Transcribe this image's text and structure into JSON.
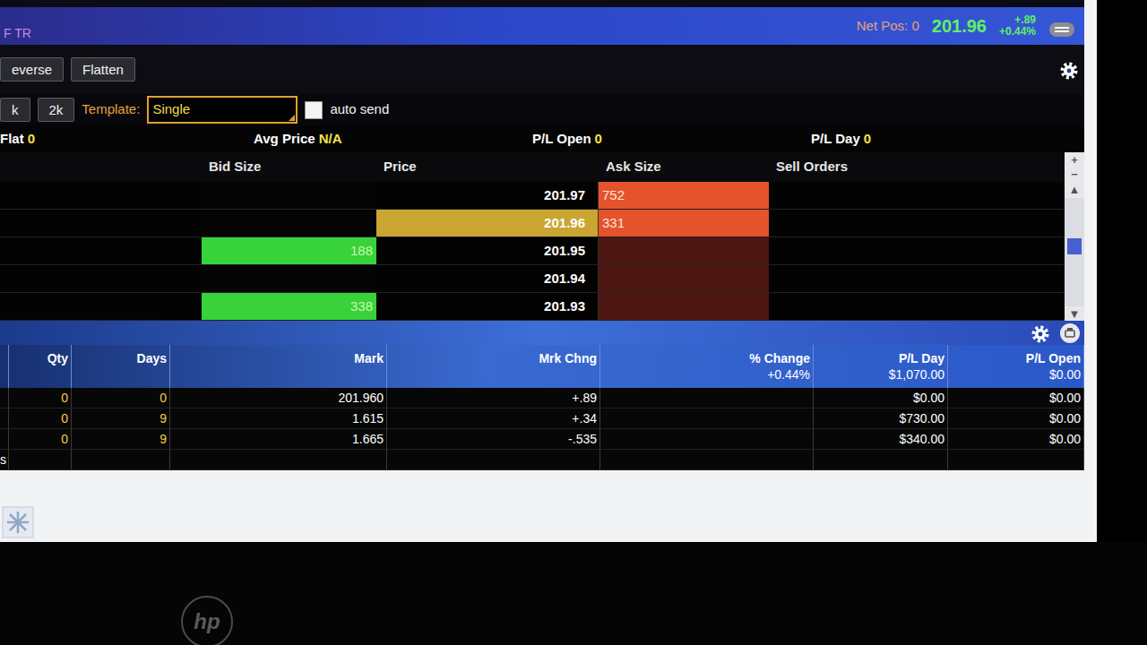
{
  "window": {
    "title": "F TR"
  },
  "quote": {
    "net_pos": "Net Pos: 0",
    "last": "201.96",
    "change": "+.89",
    "change_pct": "+0.44%"
  },
  "actions": [
    {
      "label": "everse"
    },
    {
      "label": "Flatten"
    }
  ],
  "order_entry": {
    "quantities": [
      "k",
      "2k"
    ],
    "template_label": "Template:",
    "template": "Single",
    "auto_send": {
      "label": "auto send",
      "checked": false
    }
  },
  "position": [
    {
      "label": "Flat",
      "value": "0"
    },
    {
      "label": "Avg Price",
      "value": "N/A"
    },
    {
      "label": "P/L Open",
      "value": "0"
    },
    {
      "label": "P/L Day",
      "value": "0"
    }
  ],
  "ladder": {
    "columns": [
      "Bid Size",
      "Price",
      "Ask Size",
      "Sell Orders"
    ],
    "rows": [
      {
        "price": "201.97",
        "bid": "",
        "ask": "752",
        "bid_on": false,
        "ask_on": true,
        "selected": false
      },
      {
        "price": "201.96",
        "bid": "",
        "ask": "331",
        "bid_on": false,
        "ask_on": true,
        "selected": true
      },
      {
        "price": "201.95",
        "bid": "188",
        "ask": "",
        "bid_on": true,
        "ask_on": false,
        "selected": false
      },
      {
        "price": "201.94",
        "bid": "",
        "ask": "",
        "bid_on": false,
        "ask_on": false,
        "selected": false
      },
      {
        "price": "201.93",
        "bid": "338",
        "ask": "",
        "bid_on": true,
        "ask_on": false,
        "selected": false
      }
    ]
  },
  "scroll": {
    "zoom_in": "+",
    "zoom_out": "−",
    "up": "▲",
    "down": "▼",
    "level": 0.45
  },
  "positions_table": {
    "columns": [
      "",
      "Qty",
      "Days",
      "Mark",
      "Mrk Chng",
      "% Change",
      "P/L Day",
      "P/L Open"
    ],
    "totals": [
      "",
      "",
      "",
      "",
      "",
      "+0.44%",
      "$1,070.00",
      "$0.00"
    ],
    "rows": [
      [
        "",
        "0",
        "0",
        "201.960",
        "+.89",
        "",
        "$0.00",
        "$0.00"
      ],
      [
        "",
        "0",
        "9",
        "1.615",
        "+.34",
        "",
        "$730.00",
        "$0.00"
      ],
      [
        "",
        "0",
        "9",
        "1.665",
        "-.535",
        "",
        "$340.00",
        "$0.00"
      ],
      [
        "s",
        "",
        "",
        "",
        "",
        "",
        "",
        ""
      ]
    ]
  },
  "monitor": {
    "brand": "hp"
  }
}
